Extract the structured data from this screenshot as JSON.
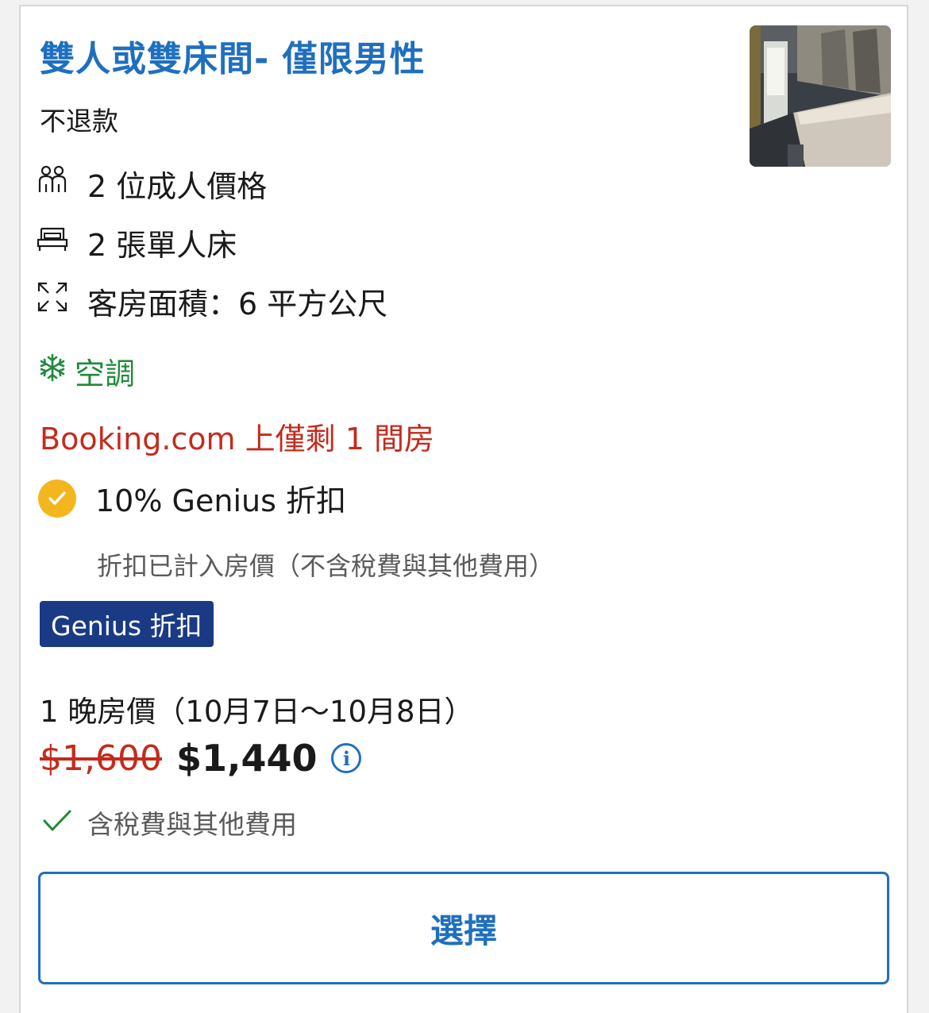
{
  "room": {
    "title": "雙人或雙床間- 僅限男性",
    "refund_policy": "不退款",
    "thumbnail_icon": "room-photo"
  },
  "features": [
    {
      "icon": "people-icon",
      "text": "2 位成人價格"
    },
    {
      "icon": "bed-icon",
      "text": "2 張單人床"
    },
    {
      "icon": "expand-icon",
      "text": "客房面積：6 平方公尺"
    }
  ],
  "amenity": {
    "icon": "snowflake-icon",
    "text": "空調"
  },
  "scarcity": "Booking.com 上僅剩 1 間房",
  "genius": {
    "headline": "10% Genius 折扣",
    "note": "折扣已計入房價（不含稅費與其他費用）",
    "badge": "Genius 折扣"
  },
  "pricing": {
    "nights_label": "1 晚房價（10月7日～10月8日）",
    "original_price": "$1,600",
    "discounted_price": "$1,440",
    "info_glyph": "i",
    "tax_note": "含稅費與其他費用"
  },
  "actions": {
    "select_label": "選擇"
  },
  "colors": {
    "link_blue": "#1f6fbf",
    "green": "#1f8a3a",
    "red": "#c42b1c",
    "genius_navy": "#1a3a85",
    "genius_yellow": "#f4b61f"
  }
}
